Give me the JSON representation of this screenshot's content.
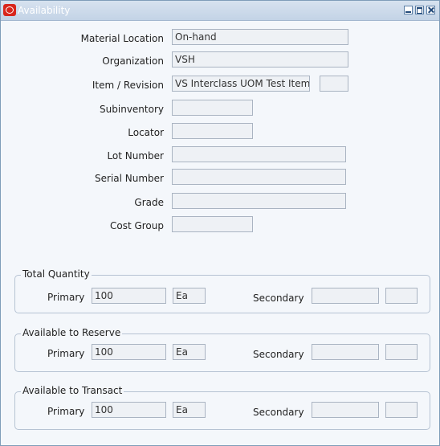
{
  "window": {
    "title": "Availability"
  },
  "form": {
    "material_location": {
      "label": "Material Location",
      "value": "On-hand"
    },
    "organization": {
      "label": "Organization",
      "value": "VSH"
    },
    "item_revision": {
      "label": "Item / Revision",
      "value": "VS Interclass UOM Test Item",
      "revision": ""
    },
    "subinventory": {
      "label": "Subinventory",
      "value": ""
    },
    "locator": {
      "label": "Locator",
      "value": ""
    },
    "lot_number": {
      "label": "Lot Number",
      "value": ""
    },
    "serial_number": {
      "label": "Serial Number",
      "value": ""
    },
    "grade": {
      "label": "Grade",
      "value": ""
    },
    "cost_group": {
      "label": "Cost Group",
      "value": ""
    }
  },
  "groups": {
    "total_quantity": {
      "title": "Total Quantity",
      "primary_label": "Primary",
      "primary_qty": "100",
      "primary_uom": "Ea",
      "secondary_label": "Secondary",
      "secondary_qty": "",
      "secondary_uom": ""
    },
    "available_to_reserve": {
      "title": "Available to Reserve",
      "primary_label": "Primary",
      "primary_qty": "100",
      "primary_uom": "Ea",
      "secondary_label": "Secondary",
      "secondary_qty": "",
      "secondary_uom": ""
    },
    "available_to_transact": {
      "title": "Available to Transact",
      "primary_label": "Primary",
      "primary_qty": "100",
      "primary_uom": "Ea",
      "secondary_label": "Secondary",
      "secondary_qty": "",
      "secondary_uom": ""
    }
  }
}
